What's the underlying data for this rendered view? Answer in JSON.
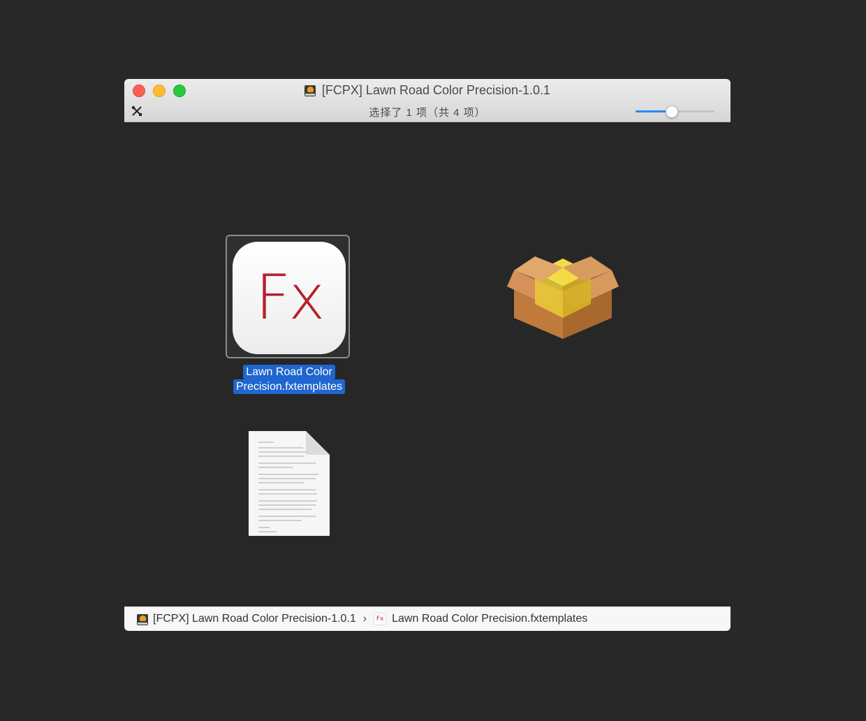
{
  "window": {
    "title": "[FCPX] Lawn Road Color Precision-1.0.1",
    "status": "选择了 1 项（共 4 项）",
    "icon_size_slider_percent": 45
  },
  "items": [
    {
      "name": "Lawn Road Color Precision.fxtemplates",
      "label_line1": "Lawn Road Color",
      "label_line2": "Precision.fxtemplates",
      "icon_text": "Fx",
      "selected": true,
      "icon": "fx-template-icon"
    },
    {
      "name": "",
      "icon": "package-icon",
      "selected": false
    },
    {
      "name": "",
      "icon": "document-icon",
      "selected": false
    }
  ],
  "pathbar": {
    "segments": [
      "[FCPX] Lawn Road Color Precision-1.0.1",
      "Lawn Road Color Precision.fxtemplates"
    ],
    "separator": "›",
    "mini_icon_text": "Fx"
  },
  "colors": {
    "desktop": "#282828",
    "selection": "#1f66cf",
    "fx_red": "#b6202c",
    "slider_accent": "#2a8af6"
  }
}
